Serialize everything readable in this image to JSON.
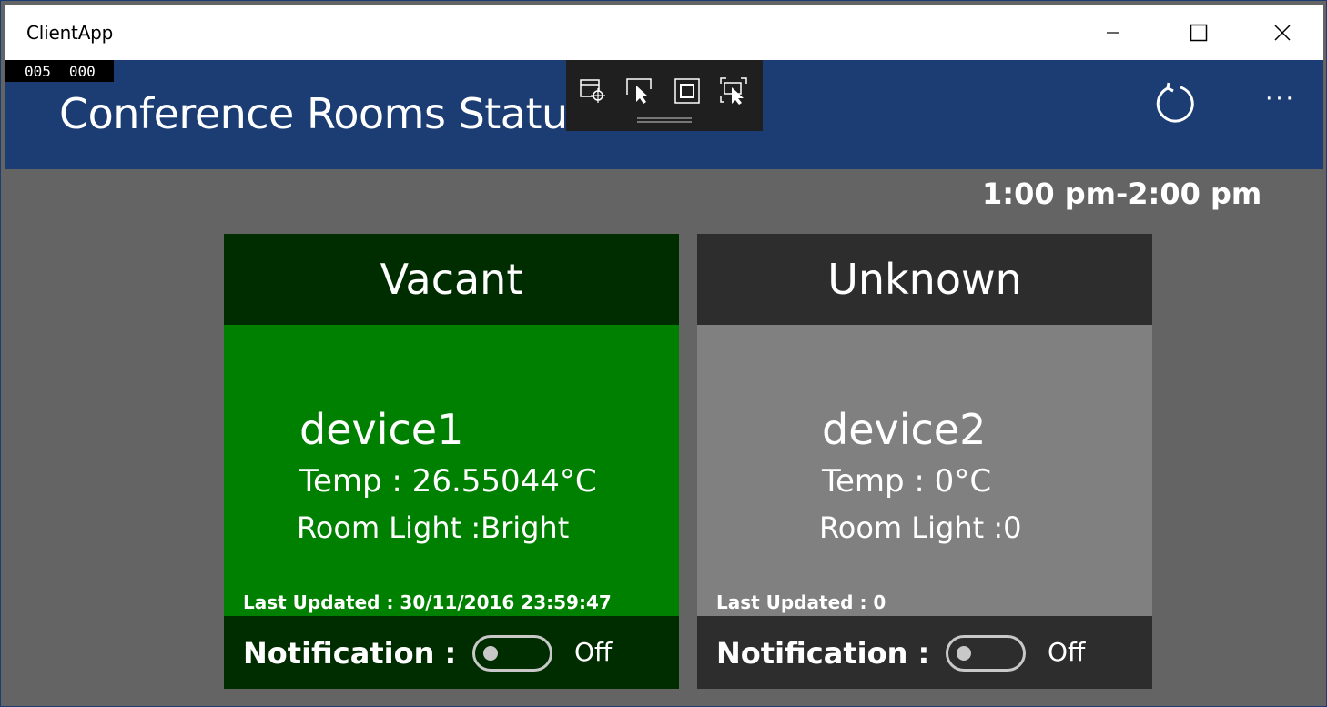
{
  "window": {
    "title": "ClientApp"
  },
  "frame_counter": [
    "005",
    "000"
  ],
  "header": {
    "page_title": "Conference Rooms Status",
    "refresh_icon": "refresh-icon",
    "more_label": "···"
  },
  "debug_toolbar": {
    "icons": [
      "select-element-icon",
      "pointer-select-icon",
      "layout-adorner-icon",
      "track-focus-icon"
    ]
  },
  "time_slot": "1:00 pm-2:00 pm",
  "colors": {
    "header_bg": "#1b3d73",
    "page_bg": "#646464",
    "vacant_head": "#002d00",
    "vacant_body": "#008000",
    "unknown_head": "#2d2d2d",
    "unknown_body": "#808080"
  },
  "cards": [
    {
      "status": "Vacant",
      "device": "device1",
      "temp": "Temp : 26.55044°C",
      "light": "Room Light :Bright",
      "updated": "Last Updated : 30/11/2016 23:59:47",
      "notification_label": "Notification :",
      "notification_state": "Off"
    },
    {
      "status": "Unknown",
      "device": "device2",
      "temp": "Temp : 0°C",
      "light": "Room Light :0",
      "updated": "Last Updated : 0",
      "notification_label": "Notification :",
      "notification_state": "Off"
    }
  ]
}
